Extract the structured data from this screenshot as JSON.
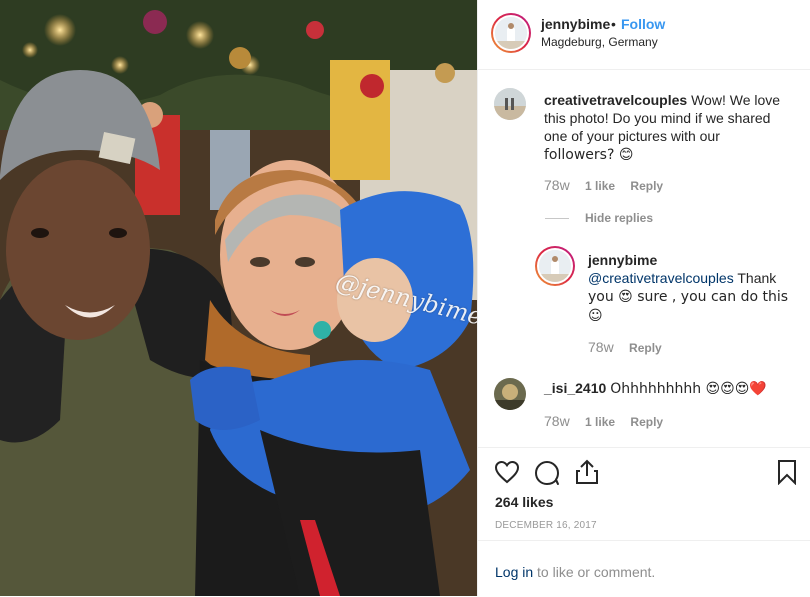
{
  "post": {
    "username": "jennybime",
    "follow_label": "Follow",
    "dot": "•",
    "location": "Magdeburg, Germany",
    "watermark": "@jennybime"
  },
  "comments": [
    {
      "username": "creativetravelcouples",
      "text_line1": "Wow! We love",
      "text_line2": "this photo! Do you mind if we shared",
      "text_line3": "one of your pictures with our",
      "text_line4": "followers? 😊",
      "age": "78w",
      "likes": "1 like",
      "reply": "Reply"
    },
    {
      "username": "_isi_2410",
      "text": "Ohhhhhhhhh 😍😍😍❤️",
      "age": "78w",
      "likes": "1 like",
      "reply": "Reply"
    }
  ],
  "hide_replies": "Hide replies",
  "reply": {
    "username": "jennybime",
    "mention": "@creativetravelcouples",
    "text_after_mention": " Thank",
    "text_line2": "you 😍 sure , you can do this",
    "text_line3": "☺",
    "age": "78w",
    "reply": "Reply"
  },
  "actions": {
    "icons": [
      "heart-icon",
      "comment-icon",
      "share-icon",
      "bookmark-icon"
    ],
    "likes": "264 likes",
    "date": "DECEMBER 16, 2017"
  },
  "footer": {
    "login": "Log in",
    "suffix": " to like or comment."
  },
  "colors": {
    "link_blue": "#3897f0",
    "mention_blue": "#003569",
    "muted": "#8e8e8e"
  }
}
